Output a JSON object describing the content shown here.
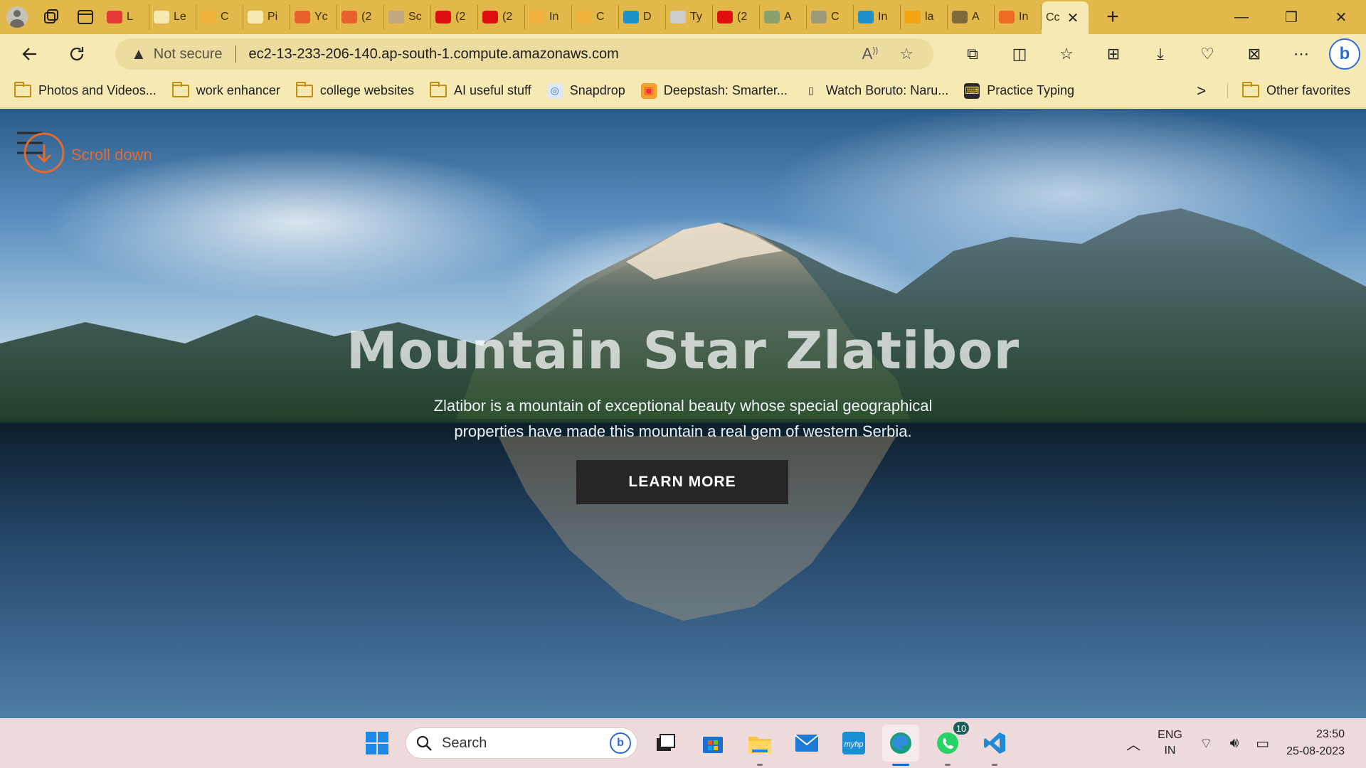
{
  "browser": {
    "tabs": [
      {
        "text": "L",
        "fav": "youtube",
        "color": "#e53935"
      },
      {
        "text": "Le",
        "fav": "page",
        "color": "#f6e9b4"
      },
      {
        "text": "C",
        "fav": "gmail",
        "color": "#f0b23c"
      },
      {
        "text": "Pi",
        "fav": "page",
        "color": "#f6e9b4"
      },
      {
        "text": "Yc",
        "fav": "youtube",
        "color": "#e8612c"
      },
      {
        "text": "(2",
        "fav": "youtube",
        "color": "#e8612c"
      },
      {
        "text": "Sc",
        "fav": "D",
        "color": "#bfa880"
      },
      {
        "text": "(2",
        "fav": "youtube",
        "color": "#e01010"
      },
      {
        "text": "(2",
        "fav": "youtube",
        "color": "#e01010"
      },
      {
        "text": "In",
        "fav": "gmail",
        "color": "#f0b23c"
      },
      {
        "text": "C",
        "fav": "gmail",
        "color": "#f0b23c"
      },
      {
        "text": "D",
        "fav": "k",
        "color": "#1d8fc9"
      },
      {
        "text": "Ty",
        "fav": "google",
        "color": "#cccccc"
      },
      {
        "text": "(2",
        "fav": "youtube",
        "color": "#e01010"
      },
      {
        "text": "A",
        "fav": "img",
        "color": "#87a26c"
      },
      {
        "text": "C",
        "fav": "openai",
        "color": "#9e9a7a"
      },
      {
        "text": "In",
        "fav": "k",
        "color": "#1d8fc9"
      },
      {
        "text": "la",
        "fav": "orange",
        "color": "#f4a20f"
      },
      {
        "text": "A",
        "fav": "bank",
        "color": "#7d6a3a"
      },
      {
        "text": "In",
        "fav": "squares",
        "color": "#ef6a22"
      }
    ],
    "active_tab": {
      "text": "Cc",
      "close": "✕"
    },
    "new_tab": "+",
    "window_controls": {
      "minimize": "—",
      "restore": "❐",
      "close": "✕"
    },
    "address": {
      "warning": "Not secure",
      "url": "ec2-13-233-206-140.ap-south-1.compute.amazonaws.com"
    },
    "bookmarks": [
      {
        "label": "Photos and Videos...",
        "icon": "folder-icon"
      },
      {
        "label": "work enhancer",
        "icon": "folder-icon"
      },
      {
        "label": "college websites",
        "icon": "folder-icon"
      },
      {
        "label": "AI useful stuff",
        "icon": "folder-icon"
      },
      {
        "label": "Snapdrop",
        "icon": "snapdrop-icon"
      },
      {
        "label": "Deepstash: Smarter...",
        "icon": "deepstash-icon"
      },
      {
        "label": "Watch Boruto: Naru...",
        "icon": "page-icon"
      },
      {
        "label": "Practice Typing",
        "icon": "typing-icon"
      }
    ],
    "bookmarks_more": ">",
    "other_favorites": "Other favorites"
  },
  "page": {
    "menu_label": "Scroll down",
    "title": "Mountain Star Zlatibor",
    "subtitle": "Zlatibor is a mountain of exceptional beauty whose special geographical properties have made this mountain a real gem of western Serbia.",
    "cta": "LEARN MORE",
    "colors": {
      "accent": "#e46a2d",
      "button": "#262626"
    }
  },
  "taskbar": {
    "search_placeholder": "Search",
    "whatsapp_badge": "10",
    "lang_top": "ENG",
    "lang_bottom": "IN",
    "time": "23:50",
    "date": "25-08-2023"
  }
}
